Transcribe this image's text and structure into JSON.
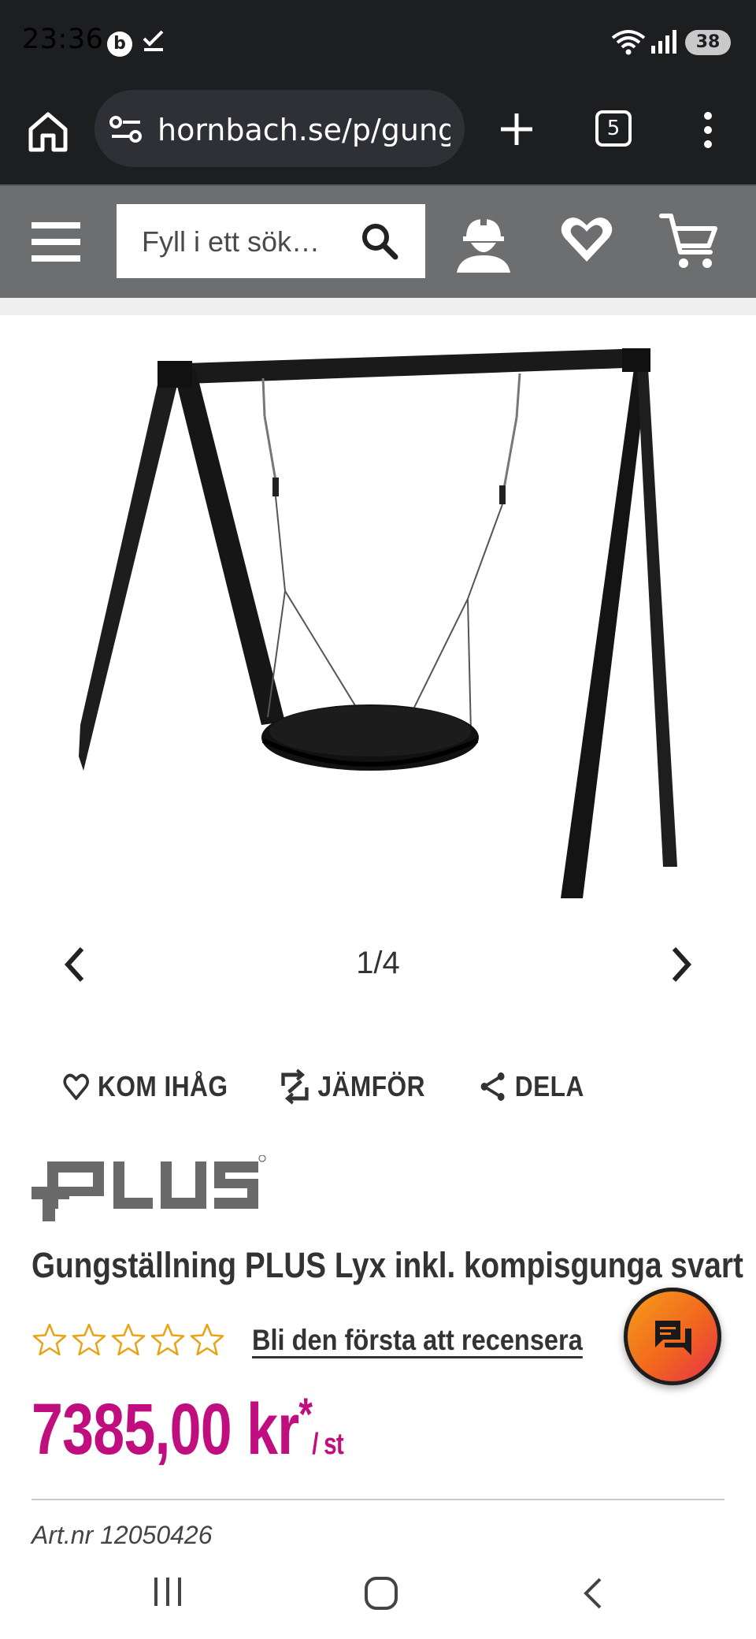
{
  "status_bar": {
    "time": "23:36",
    "notification_badge": "b",
    "battery": "38"
  },
  "browser": {
    "url": "hornbach.se/p/gungstallning-plus-lyx-inkl-kompisgunga-svart",
    "tab_count": "5"
  },
  "header": {
    "search_placeholder": "Fyll i ett sök…"
  },
  "gallery": {
    "counter": "1/4"
  },
  "actions": {
    "remember": "KOM IHÅG",
    "compare": "JÄMFÖR",
    "share": "DELA"
  },
  "product": {
    "brand": "PLUS",
    "title": "Gungställning PLUS Lyx inkl. kompisgunga svart",
    "rating_stars": 0,
    "rating_max": 5,
    "review_link": "Bli den första att recensera",
    "price": "7385,00 kr",
    "price_asterisk": "*",
    "price_unit": "/ st",
    "art_nr": "Art.nr 12050426"
  },
  "colors": {
    "accent_price": "#c10e7f",
    "header_gray": "#6d6e70",
    "star_outline": "#e8a317"
  }
}
